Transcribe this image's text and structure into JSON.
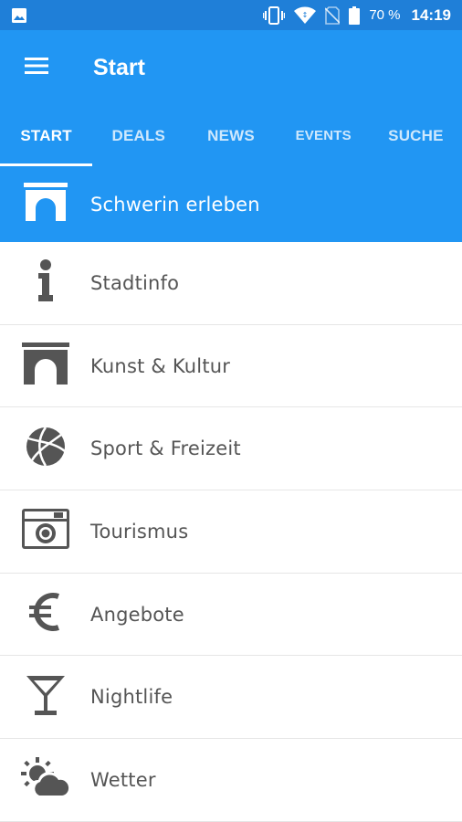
{
  "status_bar": {
    "battery": "70 %",
    "time": "14:19",
    "icons": [
      "image-icon",
      "vibrate-icon",
      "wifi-icon",
      "no-sim-icon",
      "battery-icon"
    ]
  },
  "app_bar": {
    "title": "Start",
    "menu_icon": "hamburger-menu-icon"
  },
  "tabs": [
    {
      "label": "START",
      "active": true
    },
    {
      "label": "DEALS",
      "active": false
    },
    {
      "label": "NEWS",
      "active": false
    },
    {
      "label": "EVENTS",
      "active": false
    },
    {
      "label": "SUCHE",
      "active": false
    }
  ],
  "list": [
    {
      "label": "Schwerin erleben",
      "icon": "arch-icon",
      "highlighted": true
    },
    {
      "label": "Stadtinfo",
      "icon": "info-icon"
    },
    {
      "label": "Kunst & Kultur",
      "icon": "arch-icon"
    },
    {
      "label": "Sport & Freizeit",
      "icon": "volleyball-icon"
    },
    {
      "label": "Tourismus",
      "icon": "camera-icon"
    },
    {
      "label": "Angebote",
      "icon": "euro-icon"
    },
    {
      "label": "Nightlife",
      "icon": "cocktail-icon"
    },
    {
      "label": "Wetter",
      "icon": "weather-icon"
    }
  ],
  "colors": {
    "status_bar": "#1f7fd8",
    "primary": "#2196f3",
    "icon_gray": "#555555",
    "divider": "#e6e6e6"
  }
}
